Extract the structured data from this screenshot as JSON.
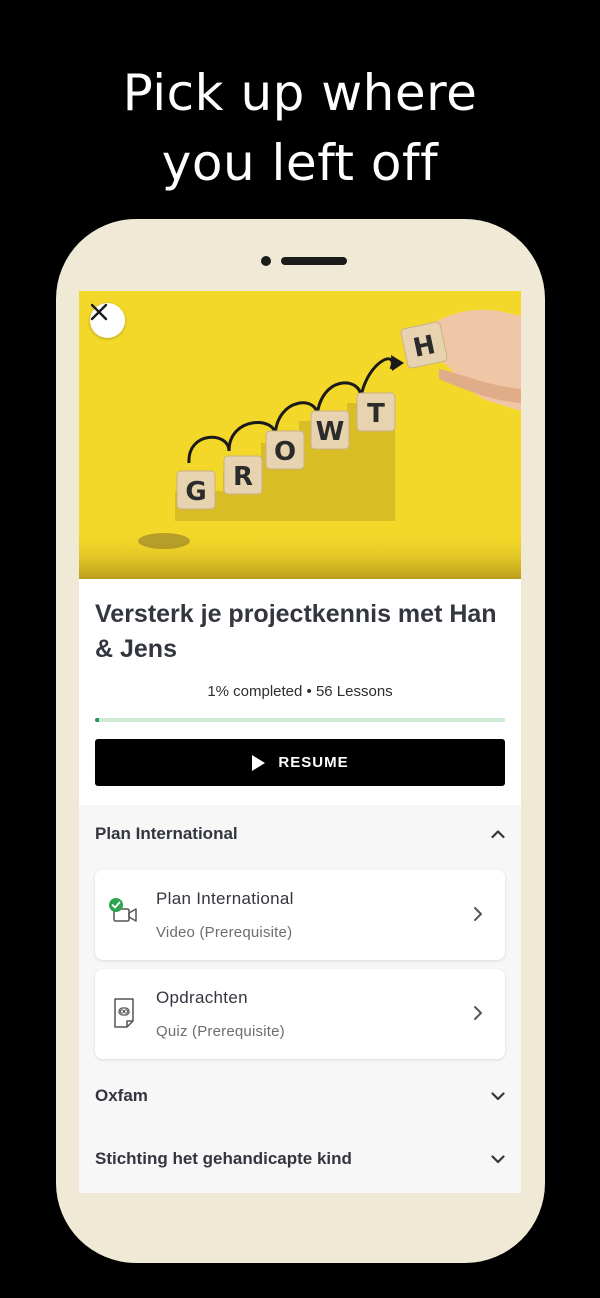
{
  "headline": {
    "line1": "Pick up where",
    "line2": "you left off"
  },
  "hero": {
    "tiles": [
      "G",
      "R",
      "O",
      "W",
      "T",
      "H"
    ],
    "colors": {
      "background": "#f4d829",
      "tile": "#e8d3b0"
    }
  },
  "course": {
    "title": "Versterk je projectkennis met Han & Jens",
    "progress_text": "1% completed • 56 Lessons",
    "progress_percent": 1,
    "resume_label": "RESUME"
  },
  "sections": [
    {
      "title": "Plan International",
      "expanded": true,
      "lessons": [
        {
          "title": "Plan International",
          "subtitle": "Video (Prerequisite)",
          "icon": "video-camera-icon",
          "completed": true
        },
        {
          "title": "Opdrachten",
          "subtitle": "Quiz (Prerequisite)",
          "icon": "quiz-icon",
          "completed": false
        }
      ]
    },
    {
      "title": "Oxfam",
      "expanded": false
    },
    {
      "title": "Stichting het gehandicapte kind",
      "expanded": false
    }
  ],
  "colors": {
    "accent": "#1f9d4c",
    "phone_frame": "#efe9d6",
    "button": "#000000"
  }
}
